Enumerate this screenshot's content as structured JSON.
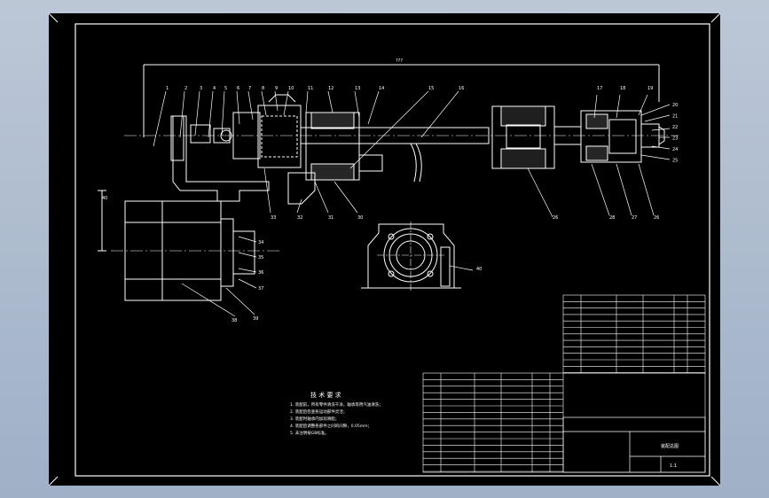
{
  "drawing": {
    "background_color": "#000000",
    "line_color": "#ffffff",
    "viewport_color": "#b0bccd",
    "overall_dim_label": "???",
    "part_numbers_top": [
      "1",
      "2",
      "3",
      "4",
      "5",
      "6",
      "7",
      "8",
      "9",
      "10",
      "11",
      "12",
      "13",
      "14",
      "15",
      "16",
      "17",
      "18",
      "19"
    ],
    "part_numbers_right": [
      "20",
      "21",
      "22",
      "23",
      "24",
      "25"
    ],
    "part_numbers_bottom": [
      "33",
      "32",
      "31",
      "30",
      "26",
      "28",
      "27",
      "26"
    ],
    "part_numbers_lower": [
      "34",
      "35",
      "36",
      "37",
      "38",
      "39",
      "40"
    ],
    "section_view_label": "40"
  },
  "notes": {
    "title": "技 术 要 求",
    "lines": [
      "1. 装配前，所有零件清洗干净，轴承等用汽油清洗；",
      "2. 装配后检查各运动部件灵活；",
      "3. 装配时轴承内加润滑脂；",
      "4. 装配后调整各部件之间的间隙，0.05mm；",
      "5. 未注明按GB标准。"
    ]
  },
  "title_block": {
    "drawing_name": "装配总图",
    "scale": "1:1"
  }
}
